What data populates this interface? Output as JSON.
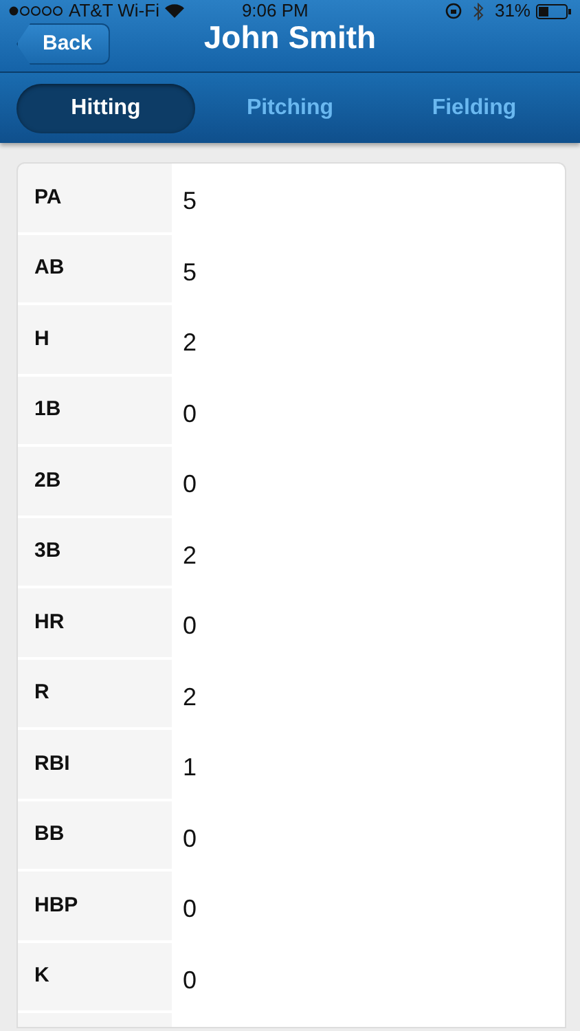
{
  "status_bar": {
    "carrier": "AT&T Wi-Fi",
    "time": "9:06 PM",
    "battery": "31%"
  },
  "nav": {
    "back": "Back",
    "title": "John Smith"
  },
  "tabs": [
    {
      "label": "Hitting",
      "selected": true
    },
    {
      "label": "Pitching",
      "selected": false
    },
    {
      "label": "Fielding",
      "selected": false
    }
  ],
  "stats": [
    {
      "label": "PA",
      "value": "5"
    },
    {
      "label": "AB",
      "value": "5"
    },
    {
      "label": "H",
      "value": "2"
    },
    {
      "label": "1B",
      "value": "0"
    },
    {
      "label": "2B",
      "value": "0"
    },
    {
      "label": "3B",
      "value": "2"
    },
    {
      "label": "HR",
      "value": "0"
    },
    {
      "label": "R",
      "value": "2"
    },
    {
      "label": "RBI",
      "value": "1"
    },
    {
      "label": "BB",
      "value": "0"
    },
    {
      "label": "HBP",
      "value": "0"
    },
    {
      "label": "K",
      "value": "0"
    }
  ]
}
